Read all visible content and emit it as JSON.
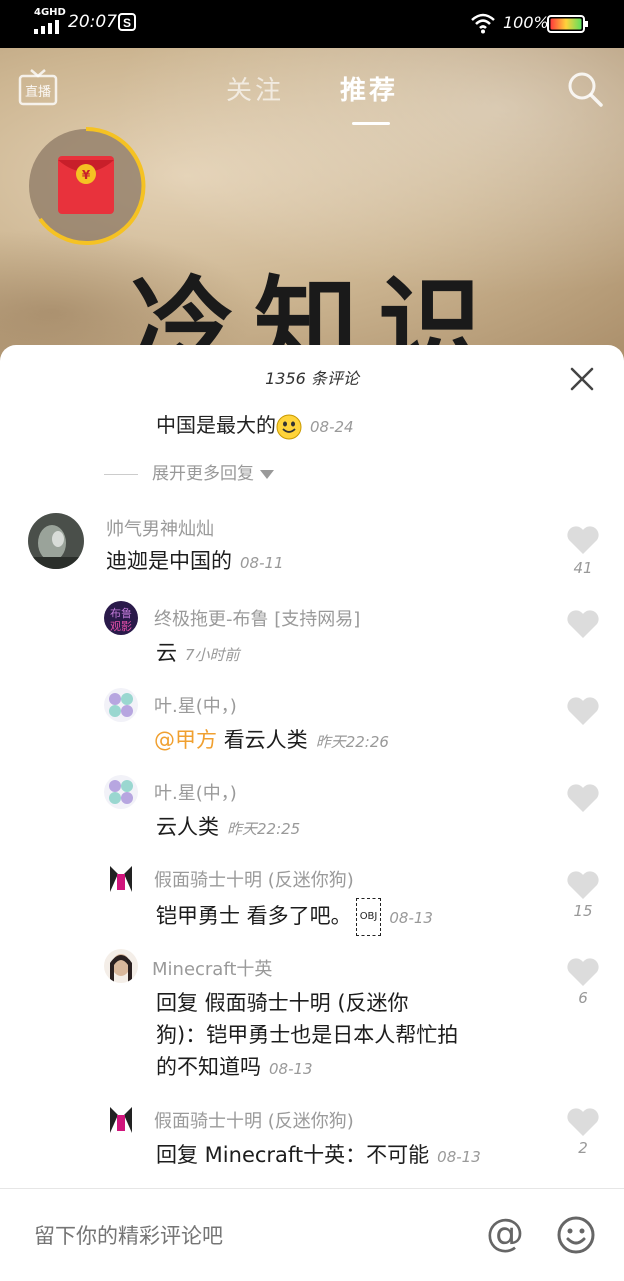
{
  "status": {
    "network": "4GHD",
    "time": "20:07",
    "battery": "100%"
  },
  "nav": {
    "tab_follow": "关注",
    "tab_recommend": "推荐"
  },
  "hero": {
    "title": "冷知识"
  },
  "comments_panel": {
    "title": "1356 条评论",
    "reply_snippet": {
      "text": "中国是最大的",
      "time": "08-24"
    },
    "expand_label": "展开更多回复",
    "items": [
      {
        "user": "帅气男神灿灿",
        "text": "迪迦是中国的",
        "time": "08-11",
        "likes": "41"
      },
      {
        "user": "终极拖更-布鲁 [支持网易]",
        "text": "云",
        "time": "7小时前",
        "likes": ""
      },
      {
        "user": "叶.星(中，)",
        "mention": "@甲方",
        "text": "看云人类",
        "time": "昨天22:26",
        "likes": ""
      },
      {
        "user": "叶.星(中，)",
        "text": "云人类",
        "time": "昨天22:25",
        "likes": ""
      },
      {
        "user": "假面骑士十明 (反迷你狗)",
        "text": "铠甲勇士 看多了吧。",
        "obj": "OBJ",
        "time": "08-13",
        "likes": "15"
      },
      {
        "user": "Minecraft十英",
        "text_line1": "回复 假面骑士十明 (反迷你",
        "text_line2": "狗)：铠甲勇士也是日本人帮忙拍",
        "text_line3": "的不知道吗",
        "time": "08-13",
        "likes": "6"
      },
      {
        "user": "假面骑士十明 (反迷你狗)",
        "text": "回复 Minecraft十英：不可能",
        "time": "08-13",
        "likes": "2"
      }
    ]
  },
  "input": {
    "placeholder": "留下你的精彩评论吧"
  },
  "colors": {
    "accent": "#f0a030",
    "heart": "#dcdcdc"
  }
}
